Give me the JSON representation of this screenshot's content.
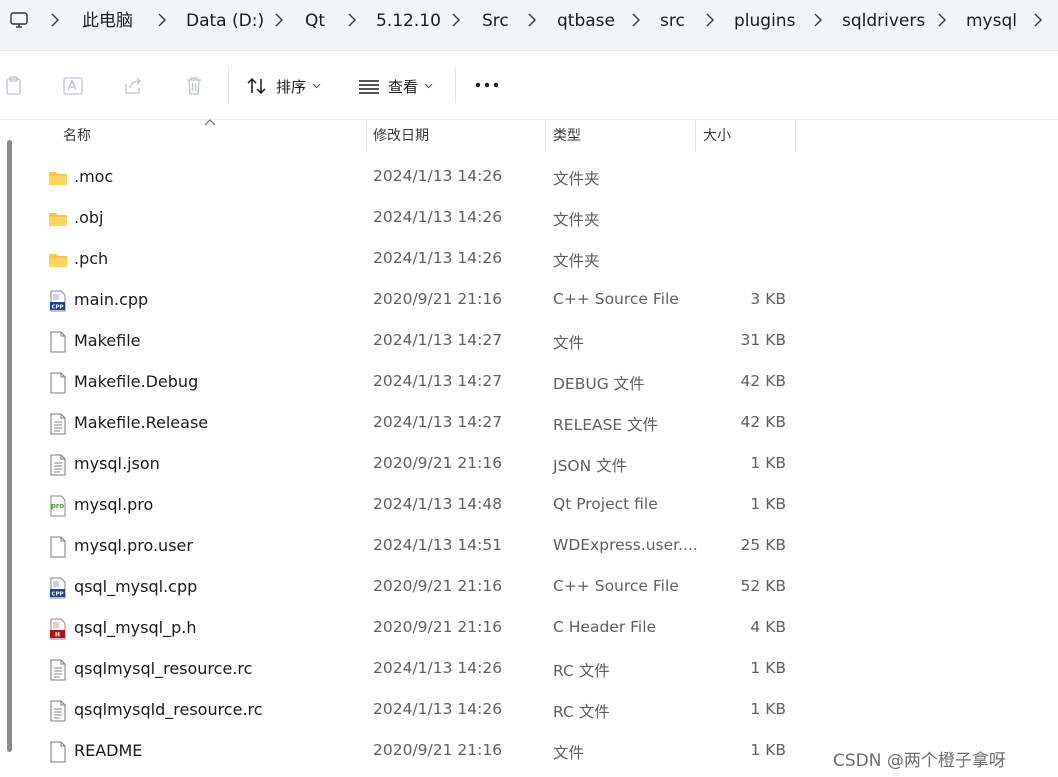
{
  "breadcrumb": [
    {
      "label": "此电脑"
    },
    {
      "label": "Data (D:)"
    },
    {
      "label": "Qt"
    },
    {
      "label": "5.12.10"
    },
    {
      "label": "Src"
    },
    {
      "label": "qtbase"
    },
    {
      "label": "src"
    },
    {
      "label": "plugins"
    },
    {
      "label": "sqldrivers"
    },
    {
      "label": "mysql"
    }
  ],
  "toolbar": {
    "icons": [
      "paste-icon",
      "rename-icon",
      "share-icon",
      "delete-icon"
    ],
    "sort_label": "排序",
    "view_label": "查看",
    "more_label": "···"
  },
  "columns": {
    "name": "名称",
    "date": "修改日期",
    "type": "类型",
    "size": "大小"
  },
  "files": [
    {
      "name": ".moc",
      "date": "2024/1/13 14:26",
      "type": "文件夹",
      "size": "",
      "icon": "folder-icon"
    },
    {
      "name": ".obj",
      "date": "2024/1/13 14:26",
      "type": "文件夹",
      "size": "",
      "icon": "folder-icon"
    },
    {
      "name": ".pch",
      "date": "2024/1/13 14:26",
      "type": "文件夹",
      "size": "",
      "icon": "folder-icon"
    },
    {
      "name": "main.cpp",
      "date": "2020/9/21 21:16",
      "type": "C++ Source File",
      "size": "3 KB",
      "icon": "cpp-file-icon"
    },
    {
      "name": "Makefile",
      "date": "2024/1/13 14:27",
      "type": "文件",
      "size": "31 KB",
      "icon": "blank-file-icon"
    },
    {
      "name": "Makefile.Debug",
      "date": "2024/1/13 14:27",
      "type": "DEBUG 文件",
      "size": "42 KB",
      "icon": "blank-file-icon"
    },
    {
      "name": "Makefile.Release",
      "date": "2024/1/13 14:27",
      "type": "RELEASE 文件",
      "size": "42 KB",
      "icon": "text-file-icon"
    },
    {
      "name": "mysql.json",
      "date": "2020/9/21 21:16",
      "type": "JSON 文件",
      "size": "1 KB",
      "icon": "text-file-icon"
    },
    {
      "name": "mysql.pro",
      "date": "2024/1/13 14:48",
      "type": "Qt Project file",
      "size": "1 KB",
      "icon": "qt-pro-file-icon"
    },
    {
      "name": "mysql.pro.user",
      "date": "2024/1/13 14:51",
      "type": "WDExpress.user....",
      "size": "25 KB",
      "icon": "blank-file-icon"
    },
    {
      "name": "qsql_mysql.cpp",
      "date": "2020/9/21 21:16",
      "type": "C++ Source File",
      "size": "52 KB",
      "icon": "cpp-file-icon"
    },
    {
      "name": "qsql_mysql_p.h",
      "date": "2020/9/21 21:16",
      "type": "C Header File",
      "size": "4 KB",
      "icon": "header-file-icon"
    },
    {
      "name": "qsqlmysql_resource.rc",
      "date": "2024/1/13 14:26",
      "type": "RC 文件",
      "size": "1 KB",
      "icon": "text-file-icon"
    },
    {
      "name": "qsqlmysqld_resource.rc",
      "date": "2024/1/13 14:26",
      "type": "RC 文件",
      "size": "1 KB",
      "icon": "text-file-icon"
    },
    {
      "name": "README",
      "date": "2020/9/21 21:16",
      "type": "文件",
      "size": "1 KB",
      "icon": "blank-file-icon"
    }
  ],
  "watermark": "CSDN @两个橙子拿呀"
}
